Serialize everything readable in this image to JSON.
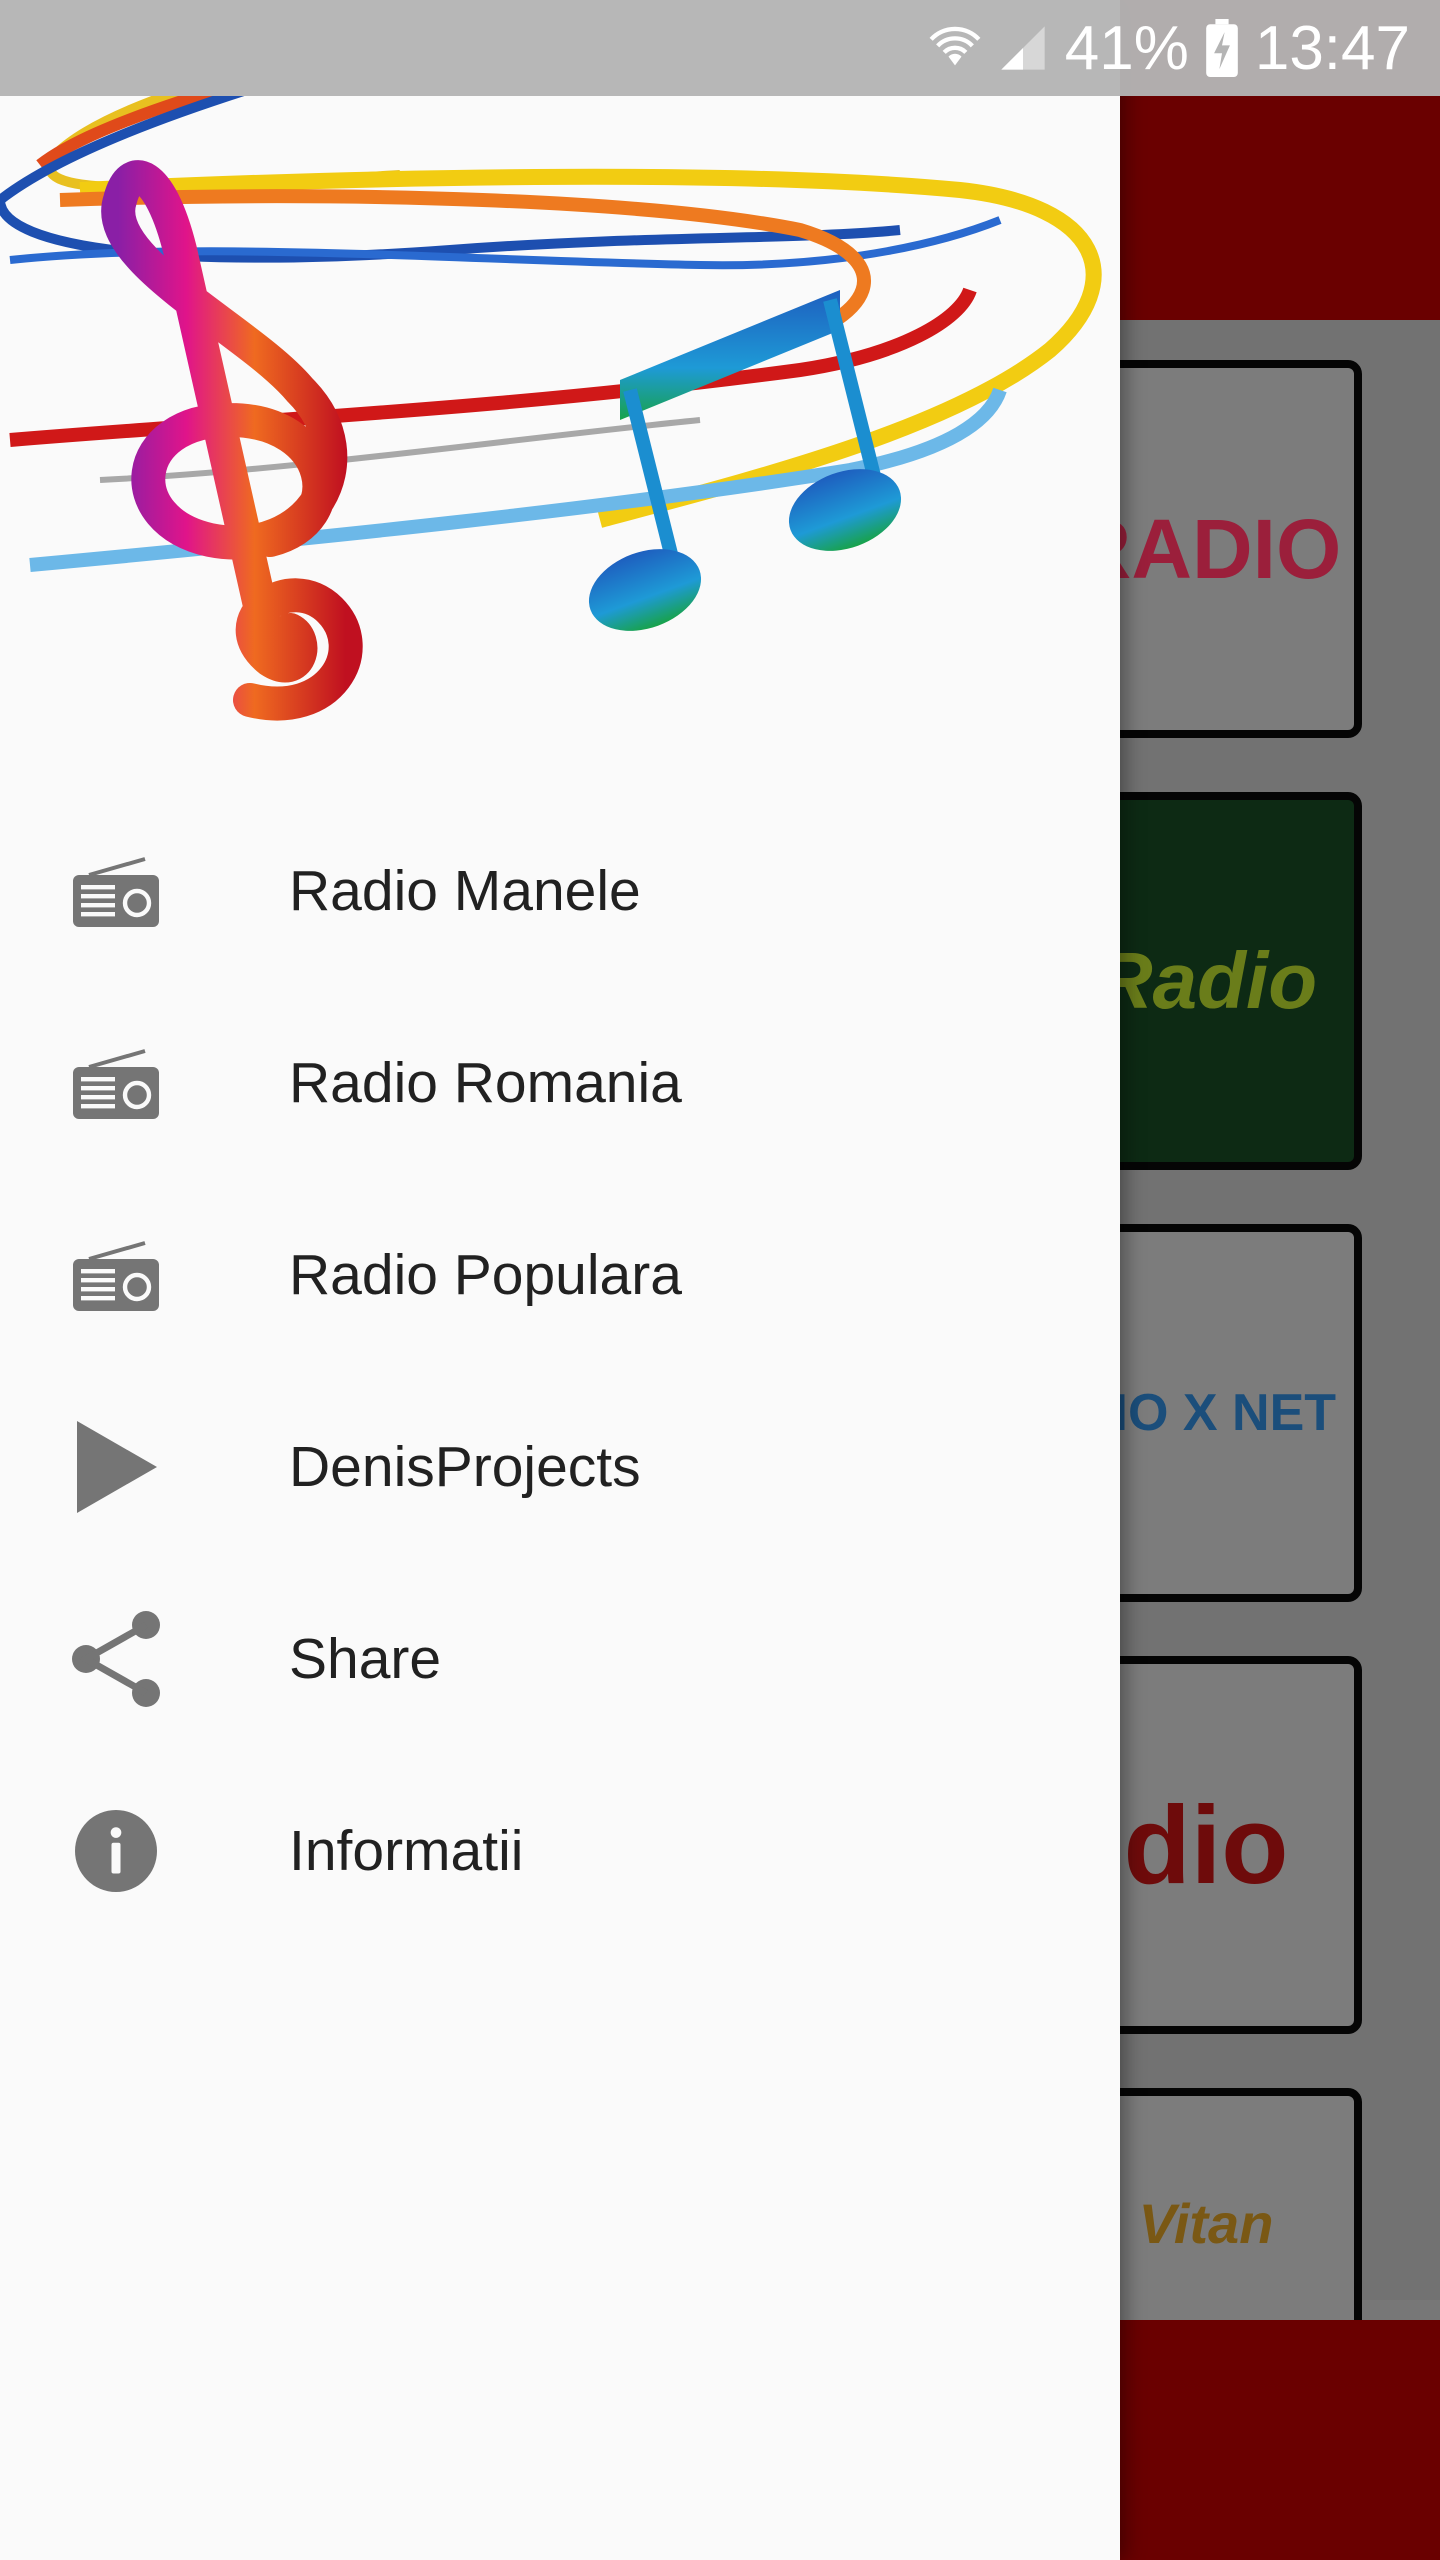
{
  "status_bar": {
    "battery": "41%",
    "time": "13:47"
  },
  "drawer": {
    "menu": [
      {
        "label": "Radio Manele",
        "icon": "radio-icon"
      },
      {
        "label": "Radio Romania",
        "icon": "radio-icon"
      },
      {
        "label": "Radio Populara",
        "icon": "radio-icon"
      },
      {
        "label": "DenisProjects",
        "icon": "play-icon"
      },
      {
        "label": "Share",
        "icon": "share-icon"
      },
      {
        "label": "Informatii",
        "icon": "info-icon"
      }
    ]
  },
  "background_stations": [
    {
      "logo_text": "RADIO"
    },
    {
      "logo_text": "Radio"
    },
    {
      "logo_text": "DIO X NET"
    },
    {
      "logo_text": "dio"
    },
    {
      "logo_text": "Vitan"
    }
  ],
  "colors": {
    "toolbar": "#6a0000",
    "drawer_bg": "#fafafa",
    "icon_gray": "#757575",
    "text": "#212121"
  }
}
